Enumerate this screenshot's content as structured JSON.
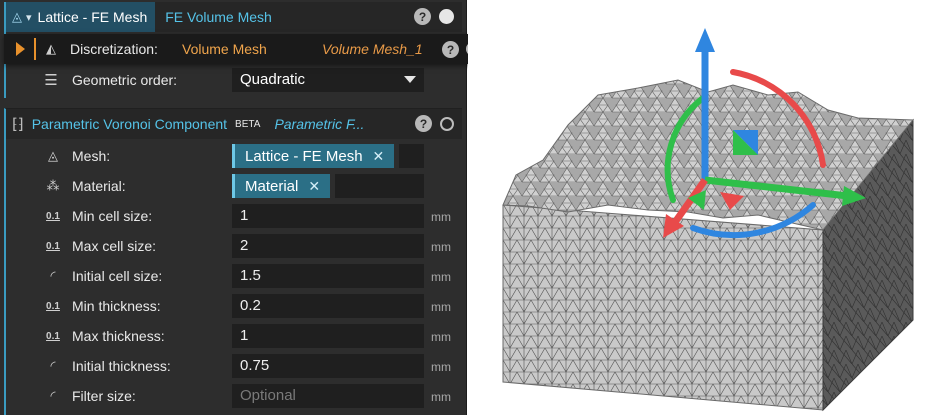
{
  "header": {
    "tab_label": "Lattice - FE Mesh",
    "subtitle": "FE Volume Mesh",
    "help": "?"
  },
  "discretization": {
    "label": "Discretization:",
    "value": "Volume Mesh",
    "alt": "Volume Mesh_1",
    "help": "?"
  },
  "geometric_order": {
    "label": "Geometric order:",
    "value": "Quadratic"
  },
  "voronoi": {
    "title": "Parametric Voronoi Component",
    "badge": "BETA",
    "subtitle": "Parametric F...",
    "help": "?"
  },
  "mesh": {
    "label": "Mesh:",
    "chip": "Lattice - FE Mesh"
  },
  "material": {
    "label": "Material:",
    "chip": "Material"
  },
  "unit": "mm",
  "params": [
    {
      "label": "Min cell size:",
      "value": "1",
      "icon": "0.1"
    },
    {
      "label": "Max cell size:",
      "value": "2",
      "icon": "0.1"
    },
    {
      "label": "Initial cell size:",
      "value": "1.5",
      "icon": "curve-icon"
    },
    {
      "label": "Min thickness:",
      "value": "0.2",
      "icon": "0.1"
    },
    {
      "label": "Max thickness:",
      "value": "1",
      "icon": "0.1"
    },
    {
      "label": "Initial thickness:",
      "value": "0.75",
      "icon": "curve-icon"
    },
    {
      "label": "Filter size:",
      "placeholder": "Optional",
      "icon": "curve-icon"
    }
  ],
  "colors": {
    "accent_blue": "#3a9bc0",
    "accent_orange": "#e8912c",
    "gizmo_red": "#e84a4a",
    "gizmo_green": "#2fbf4a",
    "gizmo_blue": "#2f86e0"
  }
}
